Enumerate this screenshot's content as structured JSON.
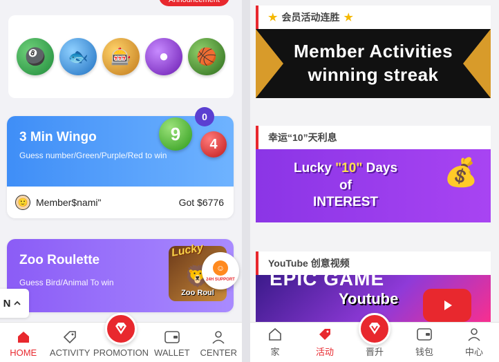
{
  "left": {
    "announcement": "Announcement",
    "games": [
      {
        "name": "lottery-icon",
        "color": "#2aa84a"
      },
      {
        "name": "fishing-icon",
        "color": "#3aa0e8"
      },
      {
        "name": "slots-icon",
        "color": "#f0a020"
      },
      {
        "name": "casino-chips-icon",
        "color": "#8a2ad8"
      },
      {
        "name": "sports-icon",
        "color": "#3a7a2a"
      }
    ],
    "wingo": {
      "title": "3 Min Wingo",
      "subtitle": "Guess number/Green/Purple/Red to win",
      "badge": "0",
      "ball_green": "9",
      "ball_red": "4",
      "winner_name": "Member$nami\"",
      "winner_amount": "Got $6776"
    },
    "zoo": {
      "title": "Zoo Roulette",
      "subtitle": "Guess Bird/Animal To win",
      "img_lucky": "Lucky",
      "img_label": "Zoo Roul"
    },
    "support_label": "24H SUPPORT",
    "lang_code": "N",
    "tabs": {
      "home": "HOME",
      "activity": "ACTIVITY",
      "promotion": "PROMOTION",
      "wallet": "WALLET",
      "center": "CENTER"
    }
  },
  "right": {
    "section1": {
      "title": "会员活动连胜",
      "banner_line1": "Member Activities",
      "banner_line2": "winning streak"
    },
    "section2": {
      "title": "幸运“10”天利息",
      "banner_line1a": "Lucky ",
      "banner_line1b": "\"10\"",
      "banner_line1c": " Days",
      "banner_line2": "of",
      "banner_line3": "INTEREST"
    },
    "section3": {
      "title": "YouTube 创意视频",
      "banner_line1": "EPIC GAME",
      "banner_line2": "Youtube"
    },
    "tabs": {
      "home": "家",
      "activity": "活动",
      "promotion": "晋升",
      "wallet": "钱包",
      "center": "中心"
    }
  },
  "colors": {
    "accent": "#e8282e",
    "wingo_gradient_start": "#3f8ef7",
    "wingo_gradient_end": "#6fb3ff",
    "zoo_gradient_start": "#8b5cf6",
    "zoo_gradient_end": "#a98bff"
  }
}
